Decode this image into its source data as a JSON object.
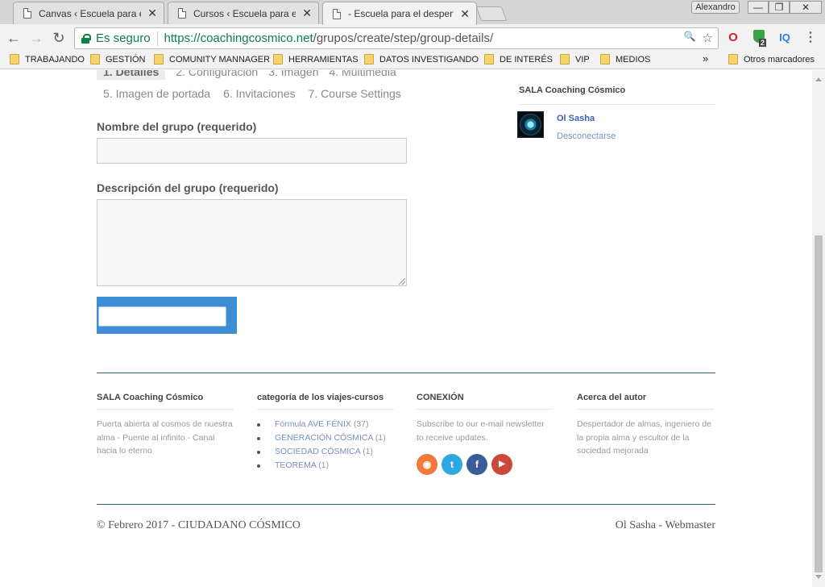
{
  "browser": {
    "tabs": [
      {
        "label": "Canvas ‹ Escuela para el despertar",
        "close": "✕"
      },
      {
        "label": "Cursos ‹ Escuela para el despertar",
        "close": "✕"
      },
      {
        "label": "- Escuela para el despertar",
        "close": "✕"
      }
    ],
    "profile_name": "Alexandro",
    "window_controls": {
      "minimize": "—",
      "restore": "❐",
      "close": "✕"
    },
    "nav": {
      "back": "←",
      "forward": "→",
      "reload": "↻"
    },
    "security_label": "Es seguro",
    "url_scheme_host": "https://coachingcosmico.net",
    "url_path": "/grupos/create/step/group-details/",
    "omnibox_icons": {
      "zoom": "🔍",
      "star": "☆"
    },
    "extensions": {
      "opera": "O",
      "shield_badge": "2",
      "iq": "IQ",
      "menu": "⋮"
    },
    "bookmarks": [
      "TRABAJANDO",
      "GESTIÓN",
      "COMUNITY MANNAGER",
      "HERRAMIENTAS",
      "DATOS INVESTIGANDO",
      "DE INTERÉS",
      "VIP",
      "MEDIOS"
    ],
    "bookmarks_overflow": "»",
    "other_bookmarks": "Otros marcadores"
  },
  "steps": {
    "row1": [
      "1. Detalles",
      "2. Configuración",
      "3. Imagen",
      "4. Multimedia"
    ],
    "row2": [
      "5. Imagen de portada",
      "6. Invitaciones",
      "7. Course Settings"
    ]
  },
  "form": {
    "name_label": "Nombre del grupo (requerido)",
    "name_value": "",
    "description_label": "Descripción del grupo (requerido)",
    "description_value": ""
  },
  "sidebar": {
    "title": "SALA Coaching Cósmico",
    "user_name": "Ol Sasha",
    "logout": "Desconectarse"
  },
  "footer": {
    "col1": {
      "heading": "SALA Coaching Cósmico",
      "text": "Puerta abierta al cosmos de nuestra alma - Puente al infinito - Canal hacia lo eterno"
    },
    "col2": {
      "heading": "categoría de los viajes-cursos",
      "items": [
        {
          "name": "Fórmula AVE FÉNIX",
          "count": "(37)"
        },
        {
          "name": "GENERACIÓN CÓSMICA",
          "count": "(1)"
        },
        {
          "name": "SOCIEDAD CÓSMICA",
          "count": "(1)"
        },
        {
          "name": "TEOREMA",
          "count": "(1)"
        }
      ]
    },
    "col3": {
      "heading": "CONEXIÓN",
      "text": "Subscribe to our e-mail newsletter to receive updates.",
      "social": [
        {
          "icon": "rss-icon",
          "glyph": "◉",
          "color": "#f0793b"
        },
        {
          "icon": "twitter-icon",
          "glyph": "t",
          "color": "#2ea8e2"
        },
        {
          "icon": "facebook-icon",
          "glyph": "f",
          "color": "#3b5b9a"
        },
        {
          "icon": "youtube-icon",
          "glyph": "▶",
          "color": "#c9483b"
        }
      ]
    },
    "col4": {
      "heading": "Acerca del autor",
      "text": "Despertador de almas, ingeniero de la propia alma y escultor de la sociedad mejorada"
    },
    "copyright": "© Febrero 2017 - CIUDADANO CÓSMICO",
    "webmaster": "Ol Sasha - Webmaster"
  }
}
